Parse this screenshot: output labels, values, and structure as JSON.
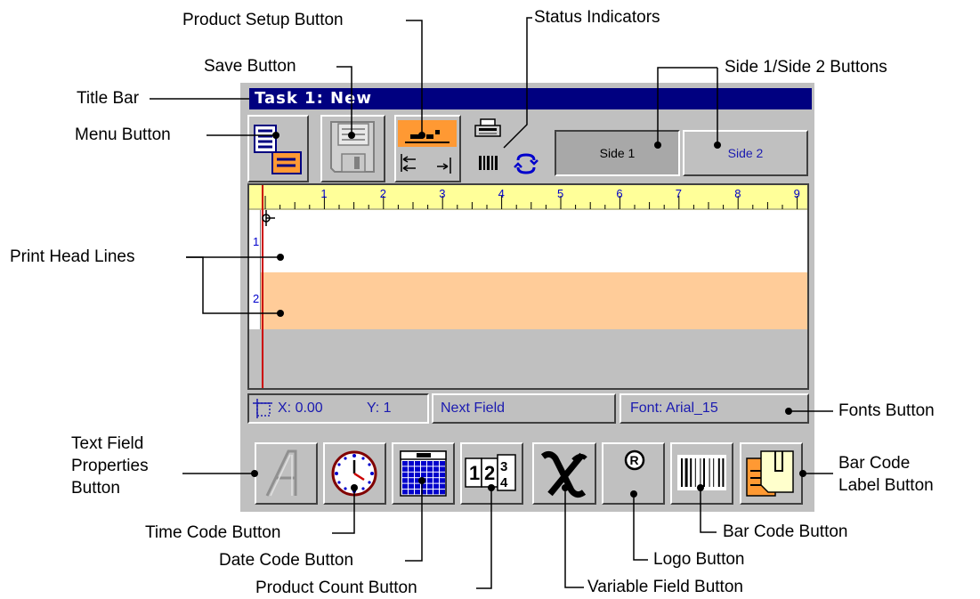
{
  "window": {
    "title": "Task 1: New",
    "side1_label": "Side 1",
    "side2_label": "Side 2"
  },
  "ruler": {
    "ticks": [
      "1",
      "2",
      "3",
      "4",
      "5",
      "6",
      "7",
      "8",
      "9"
    ]
  },
  "print_head_lines": [
    "1",
    "2"
  ],
  "status_bar": {
    "x_label": "X: 0.00",
    "y_label": "Y: 1",
    "next_field": "Next Field",
    "font": "Font: Arial_15"
  },
  "callouts": {
    "product_setup": "Product Setup Button",
    "status_indicators": "Status Indicators",
    "save": "Save Button",
    "side_buttons": "Side 1/Side 2 Buttons",
    "title_bar": "Title Bar",
    "menu": "Menu Button",
    "print_head_lines": "Print Head Lines",
    "fonts": "Fonts Button",
    "text_field_properties": "Text Field Properties Button",
    "bar_code_label": "Bar Code Label Button",
    "time_code": "Time Code Button",
    "bar_code": "Bar Code Button",
    "date_code": "Date Code Button",
    "logo": "Logo Button",
    "product_count": "Product Count Button",
    "variable_field": "Variable Field Button"
  },
  "icons": {
    "menu": "menu-icon",
    "save": "floppy-disk-icon",
    "product_setup": "product-setup-icon",
    "printer": "printer-icon",
    "barcode_status": "barcode-status-icon",
    "cycle": "cycle-arrows-icon",
    "text_properties": "outlined-letter-a-icon",
    "time_code": "clock-icon",
    "date_code": "calendar-icon",
    "product_count": "counter-icon",
    "variable_field": "variable-x-icon",
    "logo": "registered-mark-icon",
    "bar_code": "barcode-icon",
    "bar_code_label": "label-icon"
  },
  "colors": {
    "title_bar_bg": "#000080",
    "ruler_bg": "#ffff99",
    "line2_bg": "#ffcc99",
    "orange_icon": "#ff9933",
    "label_blue": "#1a1ab0"
  }
}
